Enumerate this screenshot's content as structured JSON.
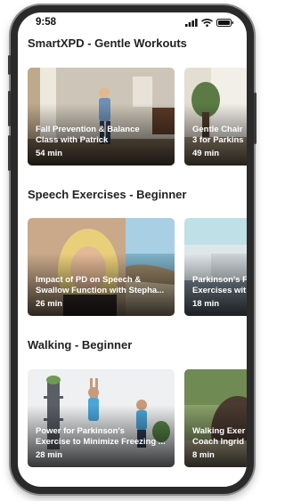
{
  "status_bar": {
    "time": "9:58"
  },
  "sections": [
    {
      "title": "SmartXPD - Gentle Workouts",
      "cards": [
        {
          "title": "Fall Prevention & Balance\nClass with Patrick",
          "duration": "54 min"
        },
        {
          "title": "Gentle Chair\n3 for Parkins",
          "duration": "49 min"
        }
      ]
    },
    {
      "title": "Speech Exercises - Beginner",
      "cards": [
        {
          "title": "Impact of PD on Speech &\nSwallow Function with Stepha...",
          "duration": "26 min"
        },
        {
          "title": "Parkinson's F\nExercises wit",
          "duration": "18 min"
        }
      ]
    },
    {
      "title": "Walking - Beginner",
      "cards": [
        {
          "title": "Power for Parkinson's\nExercise to Minimize Freezing ...",
          "duration": "28 min"
        },
        {
          "title": "Walking Exer\nCoach Ingrid",
          "duration": "8 min"
        }
      ]
    }
  ]
}
